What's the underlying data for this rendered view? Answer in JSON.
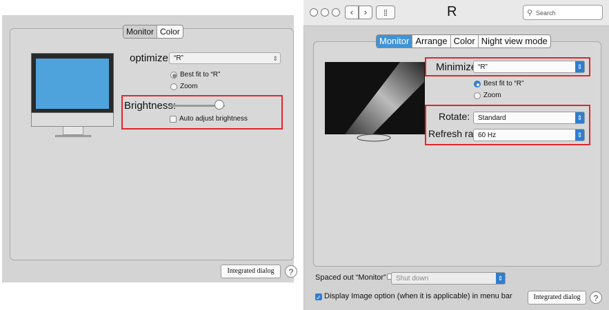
{
  "left": {
    "tabs": [
      "Monitor",
      "Color"
    ],
    "optimize_label": "optimize:",
    "optimize_value": "“R”",
    "radio_best": "Best fit to “R”",
    "radio_zoom": "Zoom",
    "brightness_label": "Brightness:",
    "brightness_level": 0.9,
    "auto_brightness": "Auto adjust brightness",
    "integrated_button": "Integrated dialog",
    "help": "?"
  },
  "right": {
    "title": "R",
    "search_placeholder": "Search",
    "tabs": [
      "Monitor",
      "Arrange",
      "Color",
      "Night view mode"
    ],
    "minimize_label": "Minimize:",
    "minimize_value": "“R”",
    "radio_best": "Best fit to “R”",
    "radio_zoom": "Zoom",
    "rotate_label": "Rotate:",
    "rotate_value": "Standard",
    "refresh_label": "Refresh rate:",
    "refresh_value": "60 Hz",
    "spaced_label": "Spaced out “Monitor”",
    "spaced_value": "Shut down",
    "display_option": "Display Image option (when it is applicable) in menu bar",
    "integrated_button": "Integrated dialog",
    "help": "?"
  },
  "colors": {
    "accent": "#2f7ed0",
    "highlight": "#e0262c",
    "screen": "#4fa3dc"
  }
}
